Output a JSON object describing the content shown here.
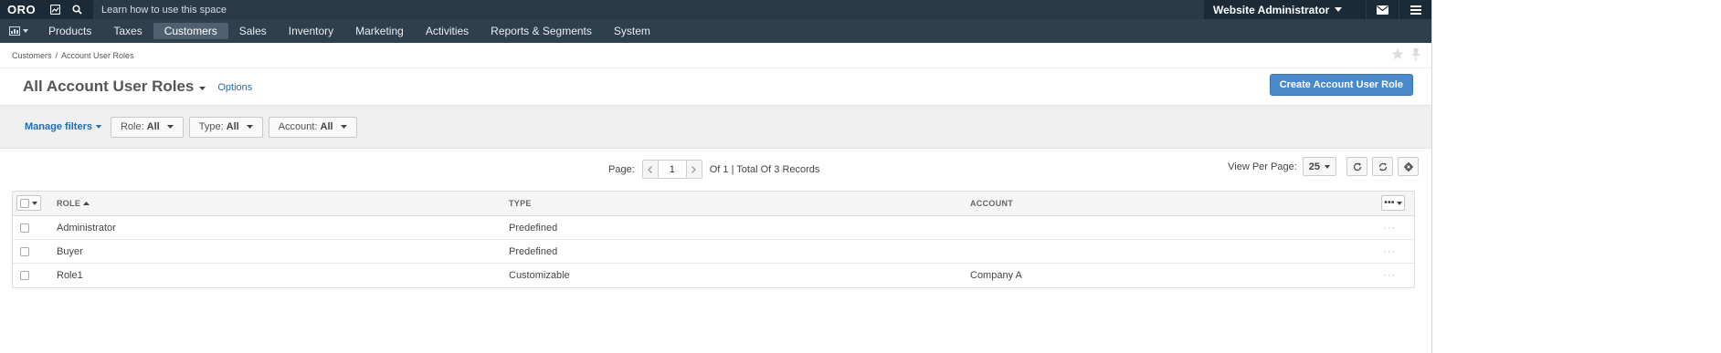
{
  "colors": {
    "topbar": "#1b2a37",
    "mainnav": "#2e3f4e",
    "active_tab": "#4f6170",
    "primary_button": "#4a89cc",
    "link": "#1e6dba"
  },
  "topbar": {
    "logo": "ORO",
    "help_hint": "Learn how to use this space",
    "user_name": "Website Administrator",
    "icons": [
      "dashboard-icon",
      "search-icon",
      "envelope-icon",
      "hamburger-menu-icon"
    ]
  },
  "mainnav": {
    "items": [
      {
        "label": "Products"
      },
      {
        "label": "Taxes"
      },
      {
        "label": "Customers",
        "active": true
      },
      {
        "label": "Sales"
      },
      {
        "label": "Inventory"
      },
      {
        "label": "Marketing"
      },
      {
        "label": "Activities"
      },
      {
        "label": "Reports & Segments"
      },
      {
        "label": "System"
      }
    ]
  },
  "breadcrumb": {
    "items": [
      "Customers",
      "Account User Roles"
    ],
    "separator": "/"
  },
  "title": {
    "text": "All Account User Roles",
    "options_link": "Options",
    "create_button": "Create Account User Role"
  },
  "filters": {
    "manage_label": "Manage filters",
    "items": [
      {
        "name": "Role",
        "value": "All"
      },
      {
        "name": "Type",
        "value": "All"
      },
      {
        "name": "Account",
        "value": "All"
      }
    ]
  },
  "pager": {
    "page_label": "Page:",
    "current_page": "1",
    "total_text": "Of 1 | Total Of 3 Records",
    "view_per_page_label": "View Per Page:",
    "per_page": "25"
  },
  "grid": {
    "columns": [
      "ROLE",
      "TYPE",
      "ACCOUNT"
    ],
    "sorted_column": "ROLE",
    "sort_direction": "ascending",
    "row_actions": "···",
    "rows": [
      {
        "role": "Administrator",
        "type": "Predefined",
        "account": ""
      },
      {
        "role": "Buyer",
        "type": "Predefined",
        "account": ""
      },
      {
        "role": "Role1",
        "type": "Customizable",
        "account": "Company A"
      }
    ]
  }
}
